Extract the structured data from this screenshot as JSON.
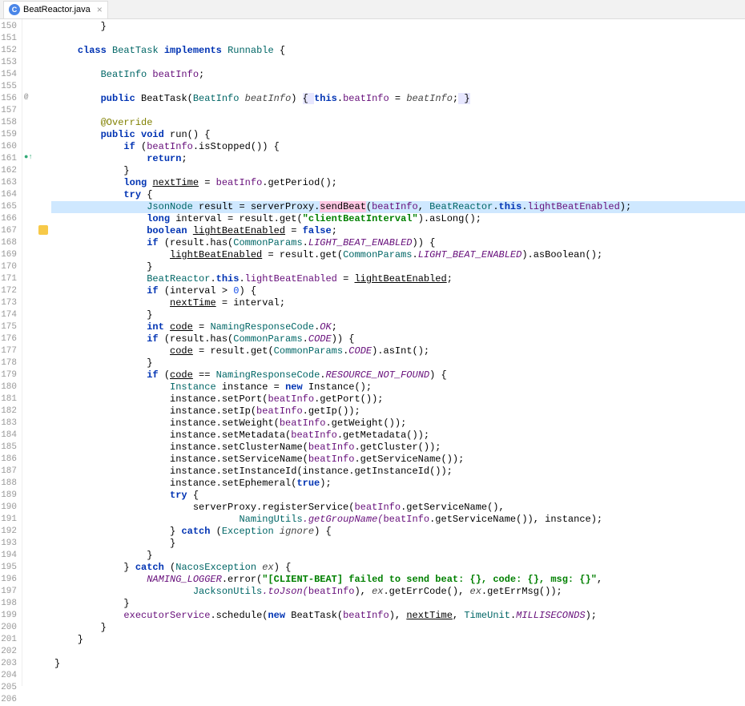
{
  "tab": {
    "icon_letter": "C",
    "title": "BeatReactor.java",
    "close": "×"
  },
  "gutter": {
    "start": 150,
    "end": 206
  },
  "marks": {
    "at156": "@",
    "at161": "●↑"
  },
  "code": {
    "l150": "        }",
    "l151": "",
    "l152_k1": "class",
    "l152_t1": "BeatTask",
    "l152_k2": "implements",
    "l152_t2": "Runnable",
    "l152_b": " {",
    "l153": "",
    "l154_t": "BeatInfo",
    "l154_f": "beatInfo",
    "l154_e": ";",
    "l155": "",
    "l156_k1": "public",
    "l156_t1": "BeatTask",
    "l156_p": "(",
    "l156_t2": "BeatInfo",
    "l156_pa": "beatInfo",
    "l156_rp": ") ",
    "l156_b1": "{ ",
    "l156_k2": "this",
    "l156_d": ".",
    "l156_f": "beatInfo",
    "l156_eq": " = ",
    "l156_pa2": "beatInfo",
    "l156_sc": ";",
    "l156_b2": " }",
    "l157": "",
    "l158_a": "@Override",
    "l159_k1": "public",
    "l159_k2": "void",
    "l159_m": "run",
    "l159_r": "() {",
    "l160_k": "if",
    "l160_r": " (",
    "l160_f": "beatInfo",
    "l160_m": ".isStopped()) {",
    "l161_k": "return",
    "l161_s": ";",
    "l162": "            }",
    "l163_k": "long",
    "l163_v": "nextTime",
    "l163_eq": " = ",
    "l163_f": "beatInfo",
    "l163_m": ".getPeriod();",
    "l164_k": "try",
    "l164_b": " {",
    "l165_t": "JsonNode",
    "l165_v": "result",
    "l165_eq": " = serverProxy.",
    "l165_m": "sendBeat",
    "l165_lp": "(",
    "l165_f": "beatInfo",
    "l165_c": ", ",
    "l165_t2": "BeatReactor",
    "l165_d": ".",
    "l165_k": "this",
    "l165_d2": ".",
    "l165_f2": "lightBeatEnabled",
    "l165_e": ");",
    "l166_k": "long",
    "l166_v": " interval = result.get(",
    "l166_s": "\"clientBeatInterval\"",
    "l166_e": ").asLong();",
    "l167_k": "boolean",
    "l167_v": "lightBeatEnabled",
    "l167_eq": " = ",
    "l167_k2": "false",
    "l167_e": ";",
    "l168_k": "if",
    "l168_r": " (result.has(",
    "l168_t": "CommonParams",
    "l168_d": ".",
    "l168_f": "LIGHT_BEAT_ENABLED",
    "l168_e": ")) {",
    "l169_v": "lightBeatEnabled",
    "l169_eq": " = result.get(",
    "l169_t": "CommonParams",
    "l169_d": ".",
    "l169_f": "LIGHT_BEAT_ENABLED",
    "l169_e": ").asBoolean();",
    "l170": "                }",
    "l171_t": "BeatReactor",
    "l171_d": ".",
    "l171_k": "this",
    "l171_d2": ".",
    "l171_f": "lightBeatEnabled",
    "l171_eq": " = ",
    "l171_v": "lightBeatEnabled",
    "l171_e": ";",
    "l172_k": "if",
    "l172_r": " (interval > ",
    "l172_n": "0",
    "l172_e": ") {",
    "l173_v": "nextTime",
    "l173_e": " = interval;",
    "l174": "                }",
    "l175_k": "int",
    "l175_v": "code",
    "l175_eq": " = ",
    "l175_t": "NamingResponseCode",
    "l175_d": ".",
    "l175_f": "OK",
    "l175_e": ";",
    "l176_k": "if",
    "l176_r": " (result.has(",
    "l176_t": "CommonParams",
    "l176_d": ".",
    "l176_f": "CODE",
    "l176_e": ")) {",
    "l177_v": "code",
    "l177_eq": " = result.get(",
    "l177_t": "CommonParams",
    "l177_d": ".",
    "l177_f": "CODE",
    "l177_e": ").asInt();",
    "l178": "                }",
    "l179_k": "if",
    "l179_r": " (",
    "l179_v": "code",
    "l179_eq": " == ",
    "l179_t": "NamingResponseCode",
    "l179_d": ".",
    "l179_f": "RESOURCE_NOT_FOUND",
    "l179_e": ") {",
    "l180_t": "Instance",
    "l180_v": " instance = ",
    "l180_k": "new",
    "l180_e": " Instance();",
    "l181": "                    instance.setPort(",
    "l181_f": "beatInfo",
    "l181_e": ".getPort());",
    "l182": "                    instance.setIp(",
    "l182_f": "beatInfo",
    "l182_e": ".getIp());",
    "l183": "                    instance.setWeight(",
    "l183_f": "beatInfo",
    "l183_e": ".getWeight());",
    "l184": "                    instance.setMetadata(",
    "l184_f": "beatInfo",
    "l184_e": ".getMetadata());",
    "l185": "                    instance.setClusterName(",
    "l185_f": "beatInfo",
    "l185_e": ".getCluster());",
    "l186": "                    instance.setServiceName(",
    "l186_f": "beatInfo",
    "l186_e": ".getServiceName());",
    "l187": "                    instance.setInstanceId(instance.getInstanceId());",
    "l188": "                    instance.setEphemeral(",
    "l188_k": "true",
    "l188_e": ");",
    "l189_k": "try",
    "l189_b": " {",
    "l190": "                        serverProxy.registerService(",
    "l190_f": "beatInfo",
    "l190_e": ".getServiceName(),",
    "l191_t": "NamingUtils",
    "l191_m": ".getGroupName(",
    "l191_f": "beatInfo",
    "l191_e": ".getServiceName()), instance);",
    "l192_b": "} ",
    "l192_k": "catch",
    "l192_r": " (",
    "l192_t": "Exception",
    "l192_p": "ignore",
    "l192_e": ") {",
    "l193": "                    }",
    "l194": "                }",
    "l195_b": "} ",
    "l195_k": "catch",
    "l195_r": " (",
    "l195_t": "NacosException",
    "l195_p": "ex",
    "l195_e": ") {",
    "l196_f": "NAMING_LOGGER",
    "l196_m": ".error(",
    "l196_s": "\"[CLIENT-BEAT] failed to send beat: {}, code: {}, msg: {}\"",
    "l196_e": ",",
    "l197_t": "JacksonUtils",
    "l197_m": ".toJson(",
    "l197_f": "beatInfo",
    "l197_r": "), ",
    "l197_p": "ex",
    "l197_m2": ".getErrCode(), ",
    "l197_p2": "ex",
    "l197_m3": ".getErrMsg());",
    "l198": "            }",
    "l199_f": "executorService",
    "l199_m": ".schedule(",
    "l199_k": "new",
    "l199_c": " BeatTask(",
    "l199_f2": "beatInfo",
    "l199_r": "), ",
    "l199_v": "nextTime",
    "l199_c2": ", ",
    "l199_t": "TimeUnit",
    "l199_d": ".",
    "l199_f3": "MILLISECONDS",
    "l199_e": ");",
    "l200": "        }",
    "l201": "    }",
    "l202": "",
    "l203": "}"
  }
}
